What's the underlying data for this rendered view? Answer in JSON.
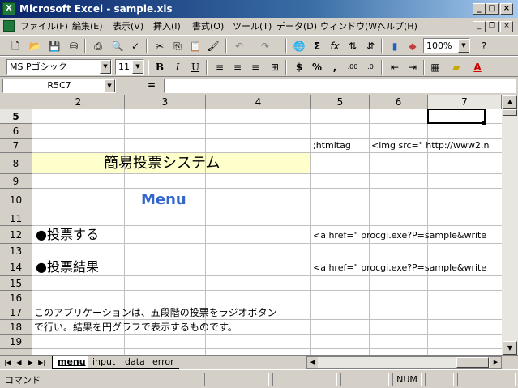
{
  "window": {
    "title": "Microsoft Excel - sample.xls",
    "app_icon_label": "X"
  },
  "caption_buttons": {
    "minimize": "_",
    "maximize": "□",
    "close": "×"
  },
  "menus": [
    "ファイル(F)",
    "編集(E)",
    "表示(V)",
    "挿入(I)",
    "書式(O)",
    "ツール(T)",
    "データ(D)",
    "ウィンドウ(W)",
    "ヘルプ(H)"
  ],
  "toolbar": {
    "zoom": "100%",
    "font_name": "MS Pゴシック",
    "font_size": "11"
  },
  "formula_bar": {
    "name_box": "R5C7",
    "equals": "=",
    "content": ""
  },
  "columns": [
    "2",
    "3",
    "4",
    "5",
    "6",
    "7"
  ],
  "rows": [
    "5",
    "6",
    "7",
    "8",
    "9",
    "10",
    "11",
    "12",
    "13",
    "14",
    "15",
    "16",
    "17",
    "18",
    "19"
  ],
  "active_cell": {
    "row": "5",
    "col": "7"
  },
  "cells": {
    "r7_c5": ";htmltag",
    "r7_c6": "<img src=\" http://www2.n",
    "r8_title": "簡易投票システム",
    "r10_menu": "Menu",
    "r12_vote": "●投票する",
    "r12_link": "<a href=\" procgi.exe?P=sample&write",
    "r14_results": "●投票結果",
    "r14_link": "<a href=\" procgi.exe?P=sample&write",
    "r17_desc": "このアプリケーションは、五段階の投票をラジオボタン",
    "r18_desc": "で行い。結果を円グラフで表示するものです。"
  },
  "sheet_tabs": [
    "menu",
    "input",
    "data",
    "error"
  ],
  "active_sheet": "menu",
  "status": {
    "mode": "コマンド",
    "num": "NUM"
  },
  "colors": {
    "title_fill": "#ffffcc",
    "menu_text": "#3366cc",
    "title_bar": "#0a246a"
  }
}
